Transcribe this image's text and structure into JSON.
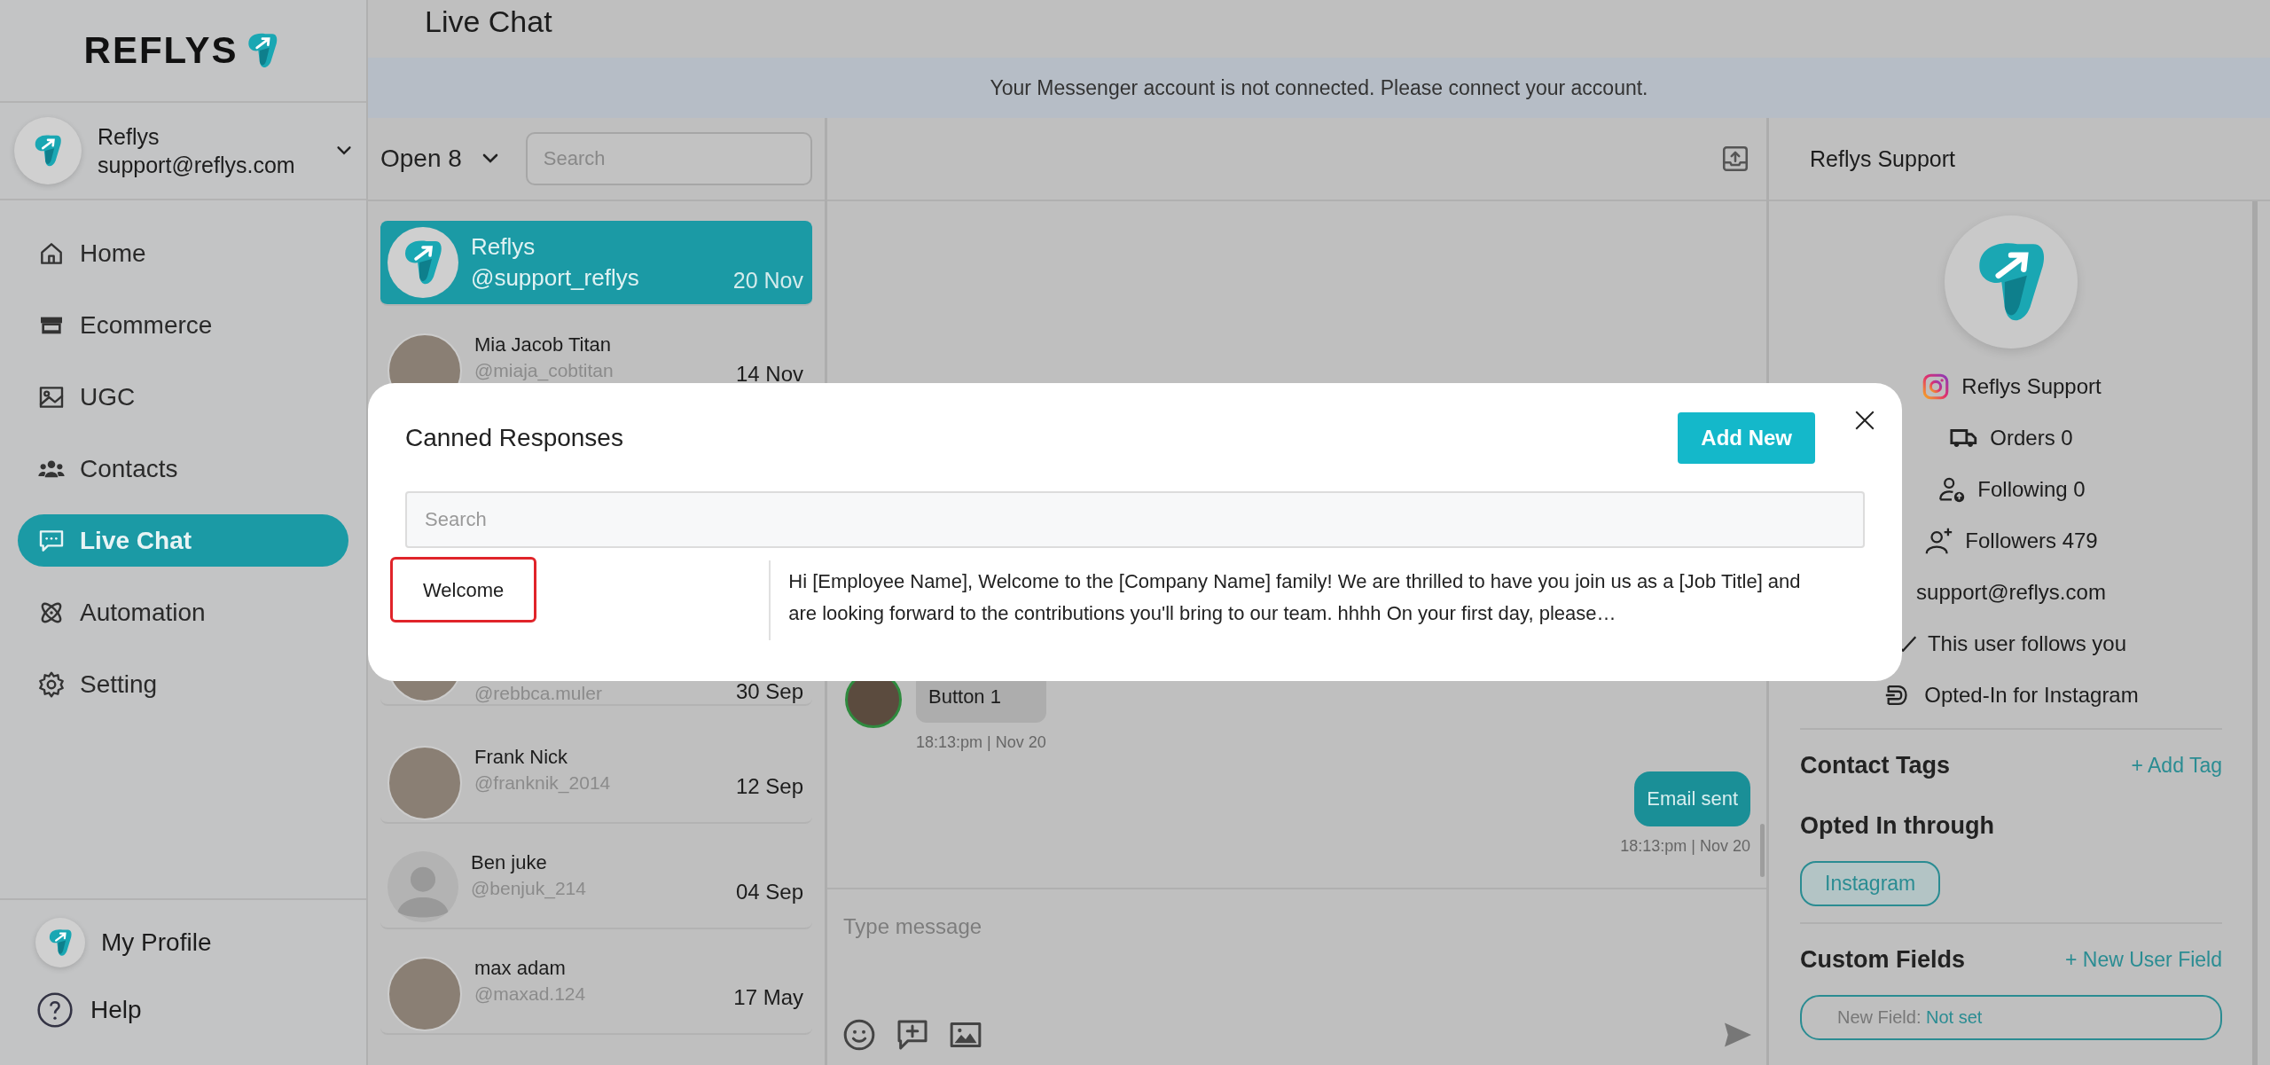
{
  "sidebar": {
    "brand": "REFLYS",
    "account": {
      "name": "Reflys",
      "email": "support@reflys.com"
    },
    "nav": [
      {
        "label": "Home",
        "selected": false
      },
      {
        "label": "Ecommerce",
        "selected": false
      },
      {
        "label": "UGC",
        "selected": false
      },
      {
        "label": "Contacts",
        "selected": false
      },
      {
        "label": "Live Chat",
        "selected": true
      },
      {
        "label": "Automation",
        "selected": false
      },
      {
        "label": "Setting",
        "selected": false
      }
    ],
    "footer": [
      {
        "label": "My Profile",
        "kind": "profile"
      },
      {
        "label": "Help",
        "kind": "help"
      }
    ]
  },
  "page_title": "Live Chat",
  "banner": "Your Messenger account is not connected. Please connect your account.",
  "conversations": {
    "filter": "Open 8",
    "search_placeholder": "Search",
    "items": [
      {
        "kind": "logo",
        "name": "Reflys",
        "handle": "@support_reflys",
        "date": "20 Nov",
        "selected": true
      },
      {
        "kind": "photo",
        "name": "Mia Jacob Titan",
        "handle": "@miaja_cobtitan",
        "date": "14 Nov",
        "selected": false
      },
      {
        "kind": "photo",
        "handle": "@rebbca.muler",
        "date": "30 Sep",
        "selected": false
      },
      {
        "kind": "photo",
        "name": "Frank Nick",
        "handle": "@franknik_2014",
        "date": "12 Sep",
        "selected": false
      },
      {
        "kind": "generic",
        "name": "Ben juke",
        "handle": "@benjuk_214",
        "date": "04 Sep",
        "selected": false
      },
      {
        "kind": "photo",
        "name": "max adam",
        "handle": "@maxad.124",
        "date": "17 May",
        "selected": false
      }
    ]
  },
  "chat": {
    "messages": [
      {
        "kind": "incoming",
        "text": "Button 1",
        "time": "18:13:pm | Nov 20"
      },
      {
        "kind": "outgoing",
        "text": "Email sent",
        "time": "18:13:pm | Nov 20"
      }
    ],
    "input_placeholder": "Type message"
  },
  "contact": {
    "title": "Reflys Support",
    "stats": [
      {
        "kind": "instagram",
        "text": "Reflys Support"
      },
      {
        "kind": "truck",
        "text": "Orders 0"
      },
      {
        "kind": "following",
        "text": "Following 0"
      },
      {
        "kind": "followers",
        "text": "Followers 479"
      },
      {
        "kind": "plain",
        "text": "support@reflys.com"
      },
      {
        "kind": "follows",
        "text": "This user follows you"
      },
      {
        "kind": "opted",
        "text": "Opted-In for Instagram"
      }
    ],
    "tags_title": "Contact Tags",
    "add_tag": "+ Add Tag",
    "opted_title": "Opted In through",
    "opted_chip": "Instagram",
    "custom_title": "Custom Fields",
    "new_field": "+ New User Field",
    "field": {
      "label": "New Field:",
      "value": "Not set"
    }
  },
  "modal": {
    "title": "Canned Responses",
    "add_button": "Add New",
    "search_placeholder": "Search",
    "responses": [
      {
        "name": "Welcome",
        "text": "Hi [Employee Name], Welcome to the [Company Name] family! We are thrilled to have you join us as a [Job Title] and are looking forward to the contributions you'll bring to our team. hhhh On your first day, please…",
        "selected": true
      }
    ]
  }
}
